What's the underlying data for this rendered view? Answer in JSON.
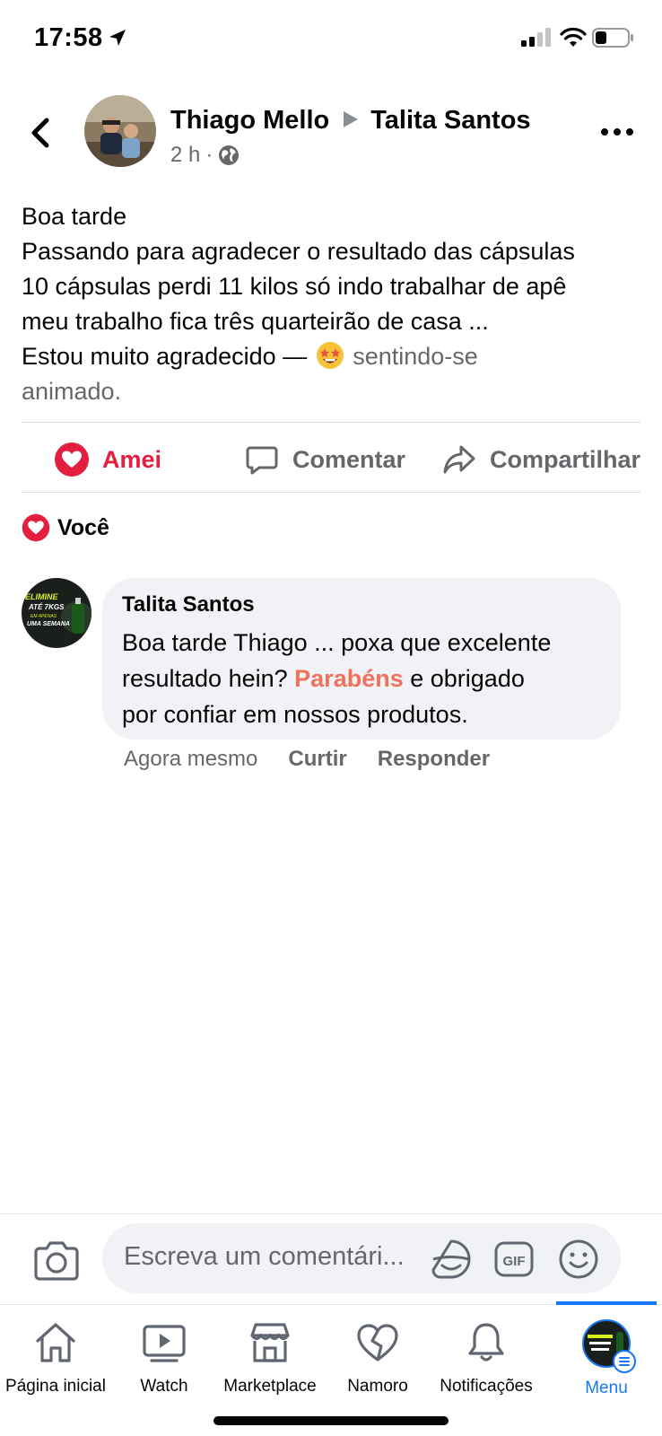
{
  "status_bar": {
    "time": "17:58"
  },
  "post": {
    "author": "Thiago Mello",
    "recipient": "Talita Santos",
    "time": "2 h",
    "dot": "·",
    "text_lines": [
      "Boa tarde",
      "Passando para agradecer o resultado das cápsulas",
      "10 cápsulas perdi 11 kilos só indo trabalhar de apê",
      "meu trabalho fica três quarteirão de casa ..."
    ],
    "last_line_start": "Estou muito agradecido —",
    "feeling_word": "sentindo-se",
    "feeling_cont": "animado."
  },
  "actions": {
    "like_label": "Amei",
    "comment_label": "Comentar",
    "share_label": "Compartilhar"
  },
  "reactions": {
    "summary": "Você"
  },
  "comment": {
    "author": "Talita Santos",
    "line1": "Boa tarde Thiago ... poxa que excelente",
    "line2_start": "resultado hein?",
    "line2_highlight": "Parabéns",
    "line2_end": "e obrigado",
    "line3": "por confiar em nossos produtos.",
    "time": "Agora mesmo",
    "like_label": "Curtir",
    "reply_label": "Responder"
  },
  "commenter_avatar_text": {
    "line1": "ELIMINE",
    "line2": "ATÉ 7KGS",
    "line3": "EM APENAS",
    "line4": "UMA SEMANA"
  },
  "composer": {
    "placeholder": "Escreva um comentári...",
    "gif_label": "GIF"
  },
  "tabbar": {
    "items": [
      {
        "label": "Página inicial"
      },
      {
        "label": "Watch"
      },
      {
        "label": "Marketplace"
      },
      {
        "label": "Namoro"
      },
      {
        "label": "Notificações"
      },
      {
        "label": "Menu"
      }
    ]
  },
  "colors": {
    "love_red": "#e41e3f",
    "highlight": "#f0725c",
    "secondary_text": "#65676b",
    "bubble": "#f0f2f5",
    "active_blue": "#1877f2"
  }
}
